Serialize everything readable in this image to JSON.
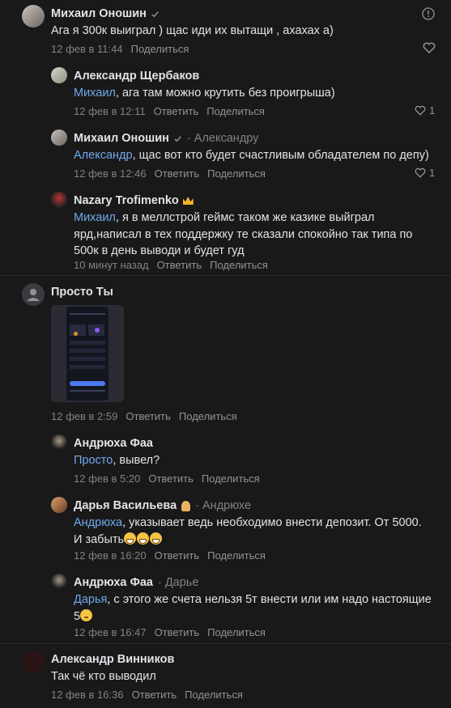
{
  "comments": [
    {
      "author": "Михаил Оношин",
      "text": "Ага я 300к выиграл ) щас иди их вытащи , ахахах а)",
      "time": "12 фев в 11:44",
      "share": "Поделиться"
    },
    {
      "author": "Александр Щербаков",
      "mention": "Михаил",
      "text": ", ага там можно крутить без проигрыша)",
      "time": "12 фев в 12:11",
      "reply": "Ответить",
      "share": "Поделиться",
      "likes": "1"
    },
    {
      "author": "Михаил Оношин",
      "reply_to": "· Александру",
      "mention": "Александр",
      "text": ", щас вот кто будет счастливым обладателем по депу)",
      "time": "12 фев в 12:46",
      "reply": "Ответить",
      "share": "Поделиться",
      "likes": "1"
    },
    {
      "author": "Nazary Trofimenko",
      "mention": "Михаил",
      "text_line1": ", я в меллстрой геймс таком же казике выйграл",
      "text_line2": "ярд,написал в тех поддержку те сказали спокойно так типа по",
      "text_line3": "500к в день выводи и будет гуд",
      "time": "10 минут назад",
      "reply": "Ответить",
      "share": "Поделиться"
    },
    {
      "author": "Просто Ты",
      "time": "12 фев в 2:59",
      "reply": "Ответить",
      "share": "Поделиться"
    },
    {
      "author": "Андрюха Фаа",
      "mention": "Просто",
      "text": ", вывел?",
      "time": "12 фев в 5:20",
      "reply": "Ответить",
      "share": "Поделиться"
    },
    {
      "author": "Дарья Васильева",
      "reply_to": "· Андрюхе",
      "mention": "Андрюха",
      "text_line1": ", указывает ведь необходимо внести депозит. От 5000.",
      "text_line2": "И забыть",
      "time": "12 фев в 16:20",
      "reply": "Ответить",
      "share": "Поделиться"
    },
    {
      "author": "Андрюха Фаа",
      "reply_to": "· Дарье",
      "mention": "Дарья",
      "text_line1": ", с этого же счета нельзя 5т внести или им надо настоящие",
      "text_line2": "5",
      "time": "12 фев в 16:47",
      "reply": "Ответить",
      "share": "Поделиться"
    },
    {
      "author": "Александр Винников",
      "text": "Так чё кто выводил",
      "time": "12 фев в 16:36",
      "reply": "Ответить",
      "share": "Поделиться"
    }
  ]
}
